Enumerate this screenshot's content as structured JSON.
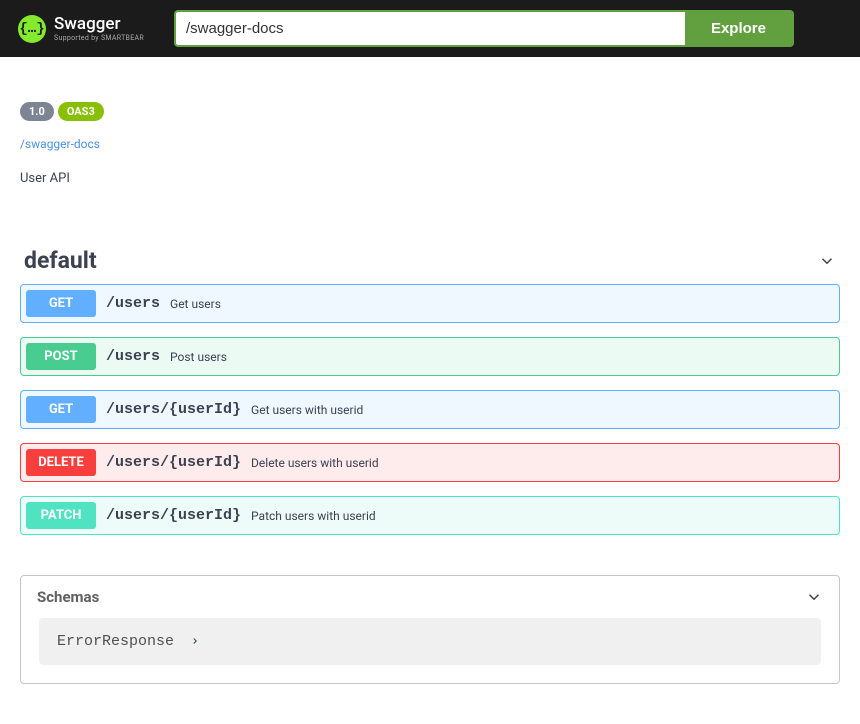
{
  "topbar": {
    "logo_glyph": "{…}",
    "logo_title": "Swagger",
    "logo_subtitle": "Supported by SMARTBEAR",
    "input_value": "/swagger-docs",
    "explore_label": "Explore"
  },
  "info": {
    "version_badge": "1.0",
    "oas_badge": "OAS3",
    "docs_link": "/swagger-docs",
    "description": "User API"
  },
  "section": {
    "title": "default"
  },
  "operations": [
    {
      "method": "GET",
      "method_class": "get",
      "path": "/users",
      "summary": "Get users"
    },
    {
      "method": "POST",
      "method_class": "post",
      "path": "/users",
      "summary": "Post users"
    },
    {
      "method": "GET",
      "method_class": "get",
      "path": "/users/{userId}",
      "summary": "Get users with userid"
    },
    {
      "method": "DELETE",
      "method_class": "delete",
      "path": "/users/{userId}",
      "summary": "Delete users with userid"
    },
    {
      "method": "PATCH",
      "method_class": "patch",
      "path": "/users/{userId}",
      "summary": "Patch users with userid"
    }
  ],
  "schemas": {
    "title": "Schemas",
    "items": [
      {
        "name": "ErrorResponse"
      }
    ]
  }
}
